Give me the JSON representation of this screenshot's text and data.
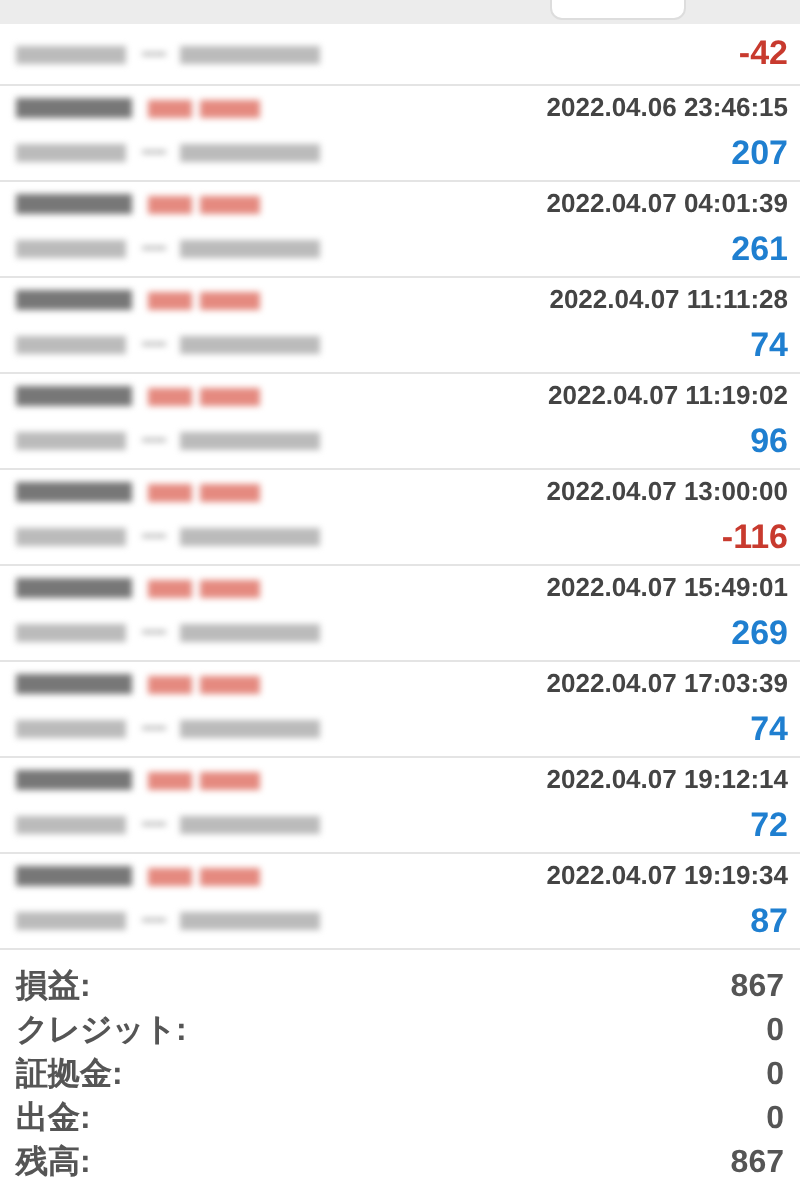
{
  "deals": [
    {
      "profit": "-42",
      "kind": "loss"
    },
    {
      "time": "2022.04.06 23:46:15",
      "profit": "207",
      "kind": "profit"
    },
    {
      "time": "2022.04.07 04:01:39",
      "profit": "261",
      "kind": "profit"
    },
    {
      "time": "2022.04.07 11:11:28",
      "profit": "74",
      "kind": "profit"
    },
    {
      "time": "2022.04.07 11:19:02",
      "profit": "96",
      "kind": "profit"
    },
    {
      "time": "2022.04.07 13:00:00",
      "profit": "-116",
      "kind": "loss"
    },
    {
      "time": "2022.04.07 15:49:01",
      "profit": "269",
      "kind": "profit"
    },
    {
      "time": "2022.04.07 17:03:39",
      "profit": "74",
      "kind": "profit"
    },
    {
      "time": "2022.04.07 19:12:14",
      "profit": "72",
      "kind": "profit"
    },
    {
      "time": "2022.04.07 19:19:34",
      "profit": "87",
      "kind": "profit"
    }
  ],
  "summary": [
    {
      "label": "損益:",
      "value": "867"
    },
    {
      "label": "クレジット:",
      "value": "0"
    },
    {
      "label": "証拠金:",
      "value": "0"
    },
    {
      "label": "出金:",
      "value": "0"
    },
    {
      "label": "残高:",
      "value": "867"
    }
  ]
}
